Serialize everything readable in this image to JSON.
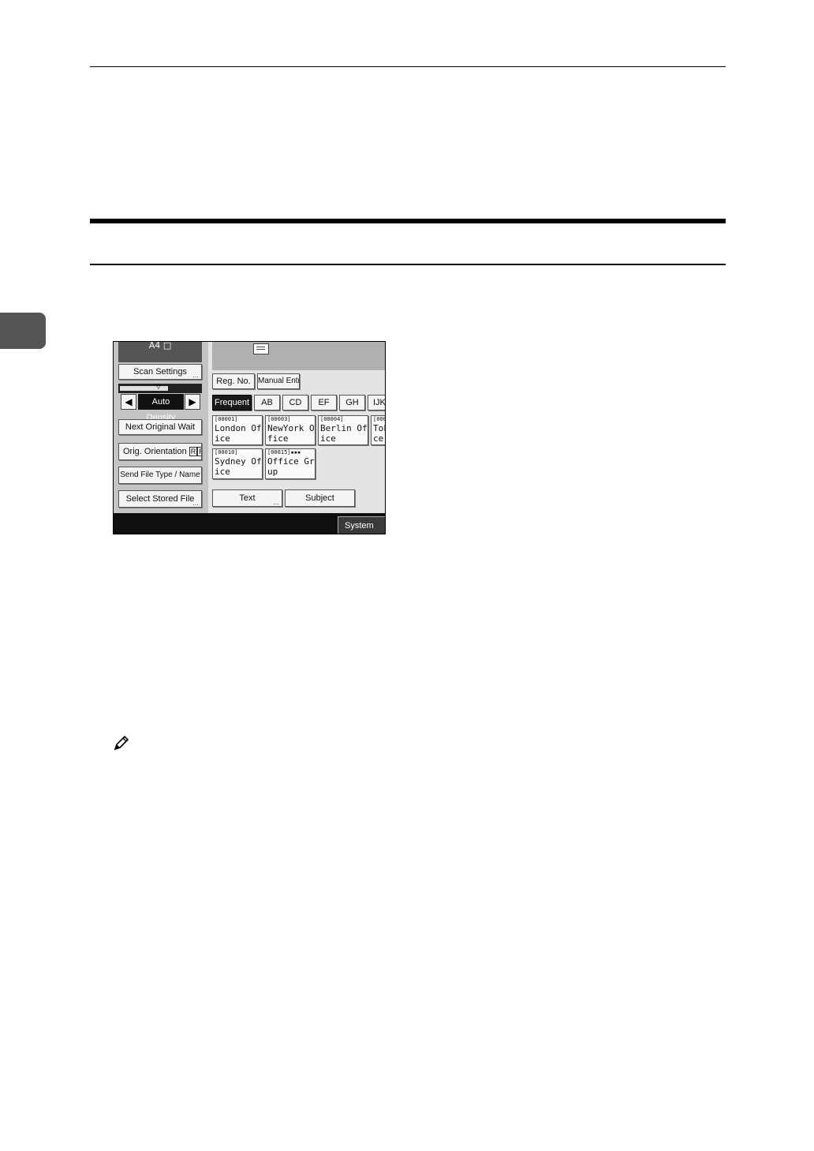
{
  "screen": {
    "paper_size": "A4",
    "scan_settings": "Scan Settings",
    "density_label": "Auto Density",
    "density_level": 0.6,
    "next_original_wait": "Next Original Wait",
    "orig_orientation": "Orig. Orientation",
    "send_file_type": "Send File Type / Name",
    "select_stored_file": "Select Stored File",
    "reg_no": "Reg. No.",
    "manual_entry": "Manual Entry",
    "tabs": [
      "Frequent",
      "AB",
      "CD",
      "EF",
      "GH",
      "IJK"
    ],
    "destinations": [
      {
        "no": "[00001]",
        "line1": "London Off",
        "line2": "ice"
      },
      {
        "no": "[00003]",
        "line1": "NewYork Of",
        "line2": "fice"
      },
      {
        "no": "[00004]",
        "line1": "Berlin Off",
        "line2": "ice"
      },
      {
        "no": "[000",
        "line1": "Tok",
        "line2": "ce"
      },
      {
        "no": "[00010]",
        "line1": "Sydney Off",
        "line2": "ice"
      },
      {
        "no": "[00015]",
        "line1": "Office Gro",
        "line2": "up"
      }
    ],
    "text_button": "Text",
    "subject_button": "Subject",
    "system_status": "System Status"
  }
}
